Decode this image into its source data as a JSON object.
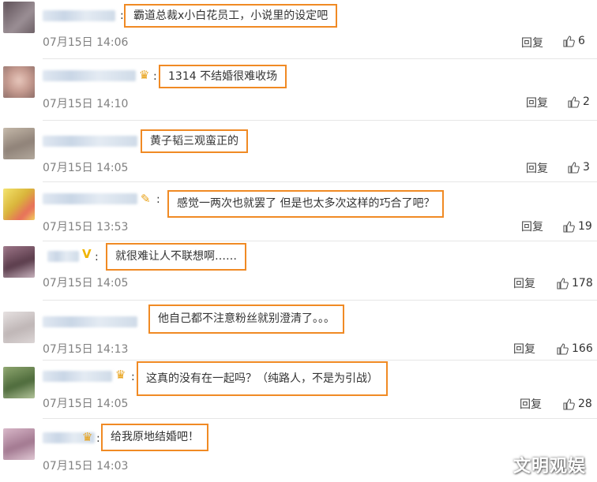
{
  "comments": [
    {
      "text": "霸道总裁x小白花员工，小说里的设定吧",
      "time": "07月15日 14:06",
      "reply": "回复",
      "likes": "6",
      "avatar_color": "#7d6f76"
    },
    {
      "text": "1314 不结婚很难收场",
      "time": "07月15日 14:10",
      "reply": "回复",
      "likes": "2",
      "avatar_color": "#c9a497"
    },
    {
      "text": "黄子韬三观蛮正的",
      "time": "07月15日 14:05",
      "reply": "回复",
      "likes": "3",
      "avatar_color": "#a8998c"
    },
    {
      "text": "感觉一两次也就罢了 但是也太多次这样的巧合了吧？",
      "time": "07月15日 13:53",
      "reply": "回复",
      "likes": "19",
      "avatar_color": "#d6c34a"
    },
    {
      "text": "就很难让人不联想啊……",
      "time": "07月15日 14:05",
      "reply": "回复",
      "likes": "178",
      "avatar_color": "#7a5565"
    },
    {
      "text": "他自己都不注意粉丝就别澄清了。。。",
      "time": "07月15日 14:13",
      "reply": "回复",
      "likes": "166",
      "avatar_color": "#cfcaca"
    },
    {
      "text": "这真的没有在一起吗？（纯路人，不是为引战）",
      "time": "07月15日 14:05",
      "reply": "回复",
      "likes": "28",
      "avatar_color": "#6f8a5a"
    },
    {
      "text": "给我原地结婚吧！",
      "time": "07月15日 14:03",
      "reply": "回复",
      "likes": "",
      "avatar_color": "#b58aa0"
    }
  ],
  "watermark": "文明观娱",
  "colors": {
    "highlight_border": "#f08a24",
    "timestamp": "#808080",
    "divider": "#e6e6e6"
  }
}
